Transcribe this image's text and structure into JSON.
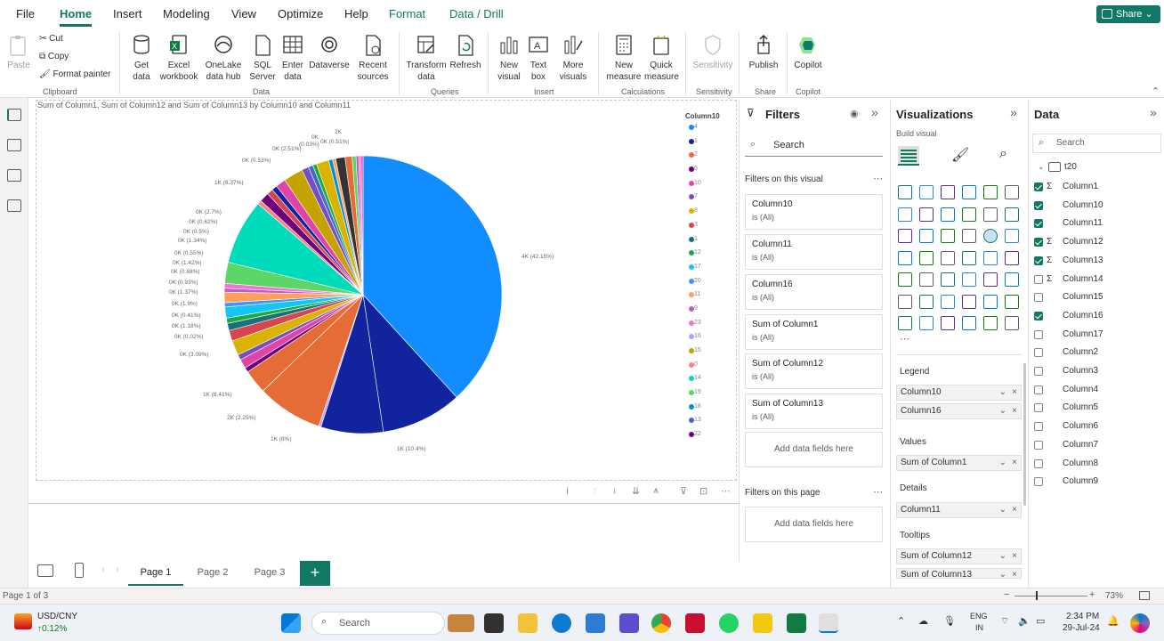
{
  "menu": {
    "items": [
      "File",
      "Home",
      "Insert",
      "Modeling",
      "View",
      "Optimize",
      "Help",
      "Format",
      "Data / Drill"
    ],
    "share_label": "Share"
  },
  "ribbon": {
    "paste": "Paste",
    "cut": "Cut",
    "copy": "Copy",
    "format_painter": "Format painter",
    "clipboard": "Clipboard",
    "get_data": "Get data",
    "excel": "Excel workbook",
    "onelake": "OneLake data hub",
    "sql": "SQL Server",
    "enter_data": "Enter data",
    "dataverse": "Dataverse",
    "recent": "Recent sources",
    "data_grp": "Data",
    "transform": "Transform data",
    "refresh": "Refresh",
    "queries": "Queries",
    "new_visual": "New visual",
    "text_box": "Text box",
    "more_visuals": "More visuals",
    "insert_grp": "Insert",
    "new_measure": "New measure",
    "quick_measure": "Quick measure",
    "calc_grp": "Calculations",
    "sensitivity": "Sensitivity",
    "sens_grp": "Sensitivity",
    "publish": "Publish",
    "share_grp": "Share",
    "copilot": "Copilot",
    "copilot_grp": "Copilot"
  },
  "visual": {
    "title": "Sum of Column1, Sum of Column12 and Sum of Column13 by Column10 and Column11",
    "legend_title": "Column10",
    "legend": [
      "4",
      "1",
      "2",
      "6",
      "10",
      "7",
      "8",
      "3",
      "1",
      "12",
      "17",
      "20",
      "11",
      "9",
      "23",
      "16",
      "15",
      "0",
      "14",
      "19",
      "18",
      "13",
      "22"
    ],
    "legend_colors": [
      "#118DFF",
      "#12239E",
      "#E66C37",
      "#6B007B",
      "#E044A7",
      "#744EC2",
      "#D9B300",
      "#D64550",
      "#197278",
      "#1AAB40",
      "#15C6F4",
      "#4092FF",
      "#FFA058",
      "#BE5DC9",
      "#F472D0",
      "#B5A1FF",
      "#C4A200",
      "#FF8080",
      "#00DBBC",
      "#5BD667",
      "#0091D5",
      "#4668C5",
      "#6B007B"
    ],
    "pie_labels": [
      "4K (42.15%)",
      "1K (10.4%)",
      "1K (8%)",
      "2K (2.25%)",
      "1K (8.41%)",
      "0K (3.09%)",
      "0K (0.02%)",
      "0K (1.18%)",
      "0K (0.41%)",
      "0K (1.9%)",
      "0K (1.37%)",
      "0K (0.93%)",
      "0K (0.68%)",
      "0K (1.42%)",
      "0K (0.55%)",
      "0K (1.34%)",
      "0K (0.5%)",
      "0K (0.62%)",
      "0K (2.7%)",
      "1K (8.37%)",
      "0K (0.53%)",
      "0K (2.51%)",
      "0K",
      "(0.03%)",
      "0K (0.51%)",
      "2K"
    ],
    "slices": [
      {
        "value": 42.15,
        "color": "#118DFF"
      },
      {
        "value": 10.4,
        "color": "#12239E"
      },
      {
        "value": 8,
        "color": "#12239E"
      },
      {
        "value": 0.3,
        "color": "#B5A1FF"
      },
      {
        "value": 8.41,
        "color": "#E66C37"
      },
      {
        "value": 3.09,
        "color": "#E66C37"
      },
      {
        "value": 0.6,
        "color": "#6B007B"
      },
      {
        "value": 1.18,
        "color": "#E044A7"
      },
      {
        "value": 0.7,
        "color": "#744EC2"
      },
      {
        "value": 1.9,
        "color": "#D9B300"
      },
      {
        "value": 1.37,
        "color": "#D64550"
      },
      {
        "value": 0.93,
        "color": "#197278"
      },
      {
        "value": 0.68,
        "color": "#1AAB40"
      },
      {
        "value": 1.42,
        "color": "#15C6F4"
      },
      {
        "value": 0.55,
        "color": "#4092FF"
      },
      {
        "value": 1.34,
        "color": "#FFA058"
      },
      {
        "value": 0.5,
        "color": "#BE5DC9"
      },
      {
        "value": 0.62,
        "color": "#F472D0"
      },
      {
        "value": 2.7,
        "color": "#5BD667"
      },
      {
        "value": 8.37,
        "color": "#00DBBC"
      },
      {
        "value": 0.53,
        "color": "#FF8080"
      },
      {
        "value": 1.2,
        "color": "#6B007B"
      },
      {
        "value": 0.8,
        "color": "#D64550"
      },
      {
        "value": 0.7,
        "color": "#12239E"
      },
      {
        "value": 1.3,
        "color": "#E044A7"
      },
      {
        "value": 2.51,
        "color": "#C4A200"
      },
      {
        "value": 0.9,
        "color": "#744EC2"
      },
      {
        "value": 0.6,
        "color": "#4668C5"
      },
      {
        "value": 0.5,
        "color": "#1AAB40"
      },
      {
        "value": 1.6,
        "color": "#D9B300"
      },
      {
        "value": 0.51,
        "color": "#0091D5"
      },
      {
        "value": 0.4,
        "color": "#FFA058"
      },
      {
        "value": 1.2,
        "color": "#333333"
      },
      {
        "value": 0.9,
        "color": "#E66C37"
      },
      {
        "value": 0.5,
        "color": "#5BD667"
      },
      {
        "value": 0.35,
        "color": "#BE5DC9"
      },
      {
        "value": 0.3,
        "color": "#F472D0"
      },
      {
        "value": 0.25,
        "color": "#E044A7"
      }
    ]
  },
  "pages": {
    "tabs": [
      "Page 1",
      "Page 2",
      "Page 3"
    ],
    "status": "Page 1 of 3",
    "zoom": "73%"
  },
  "filters": {
    "title": "Filters",
    "search": "Search",
    "on_visual": "Filters on this visual",
    "cards": [
      {
        "name": "Column10",
        "state": "is (All)"
      },
      {
        "name": "Column11",
        "state": "is (All)"
      },
      {
        "name": "Column16",
        "state": "is (All)"
      },
      {
        "name": "Sum of Column1",
        "state": "is (All)"
      },
      {
        "name": "Sum of Column12",
        "state": "is (All)"
      },
      {
        "name": "Sum of Column13",
        "state": "is (All)"
      }
    ],
    "add_fields": "Add data fields here",
    "on_page": "Filters on this page",
    "add_fields_page": "Add data fields here"
  },
  "viz": {
    "title": "Visualizations",
    "build": "Build visual",
    "legend_lbl": "Legend",
    "legend_fields": [
      "Column10",
      "Column16"
    ],
    "values_lbl": "Values",
    "values_field": "Sum of Column1",
    "details_lbl": "Details",
    "details_field": "Column11",
    "tooltips_lbl": "Tooltips",
    "tooltip_fields": [
      "Sum of Column12",
      "Sum of Column13"
    ]
  },
  "data": {
    "title": "Data",
    "search": "Search",
    "table": "t20",
    "fields": [
      {
        "name": "Column1",
        "checked": true,
        "sigma": true
      },
      {
        "name": "Column10",
        "checked": true,
        "sigma": false
      },
      {
        "name": "Column11",
        "checked": true,
        "sigma": false
      },
      {
        "name": "Column12",
        "checked": true,
        "sigma": true
      },
      {
        "name": "Column13",
        "checked": true,
        "sigma": true
      },
      {
        "name": "Column14",
        "checked": false,
        "sigma": true
      },
      {
        "name": "Column15",
        "checked": false,
        "sigma": false
      },
      {
        "name": "Column16",
        "checked": true,
        "sigma": false
      },
      {
        "name": "Column17",
        "checked": false,
        "sigma": false
      },
      {
        "name": "Column2",
        "checked": false,
        "sigma": false
      },
      {
        "name": "Column3",
        "checked": false,
        "sigma": false
      },
      {
        "name": "Column4",
        "checked": false,
        "sigma": false
      },
      {
        "name": "Column5",
        "checked": false,
        "sigma": false
      },
      {
        "name": "Column6",
        "checked": false,
        "sigma": false
      },
      {
        "name": "Column7",
        "checked": false,
        "sigma": false
      },
      {
        "name": "Column8",
        "checked": false,
        "sigma": false
      },
      {
        "name": "Column9",
        "checked": false,
        "sigma": false
      }
    ]
  },
  "taskbar": {
    "ticker": "USD/CNY",
    "change": "↑0.12%",
    "search": "Search",
    "lang1": "ENG",
    "lang2": "IN",
    "time": "2:34 PM",
    "date": "29-Jul-24"
  }
}
